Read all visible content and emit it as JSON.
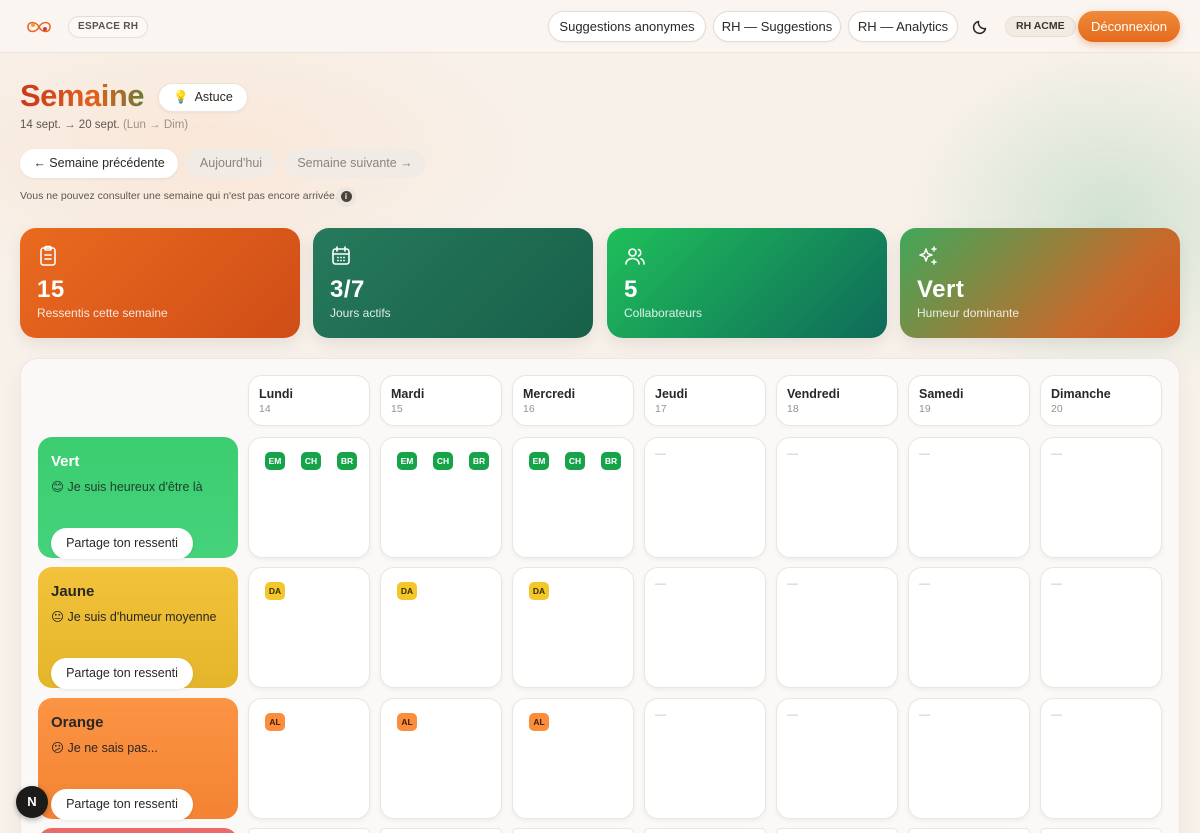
{
  "topbar": {
    "espace": "ESPACE RH",
    "nav": [
      "Suggestions anonymes",
      "RH — Suggestions",
      "RH — Analytics"
    ],
    "company": "RH ACME",
    "logout": "Déconnexion"
  },
  "header": {
    "title": "Semaine",
    "tip": "Astuce",
    "range": "14 sept. → 20 sept.",
    "range_hint": "(Lun → Dim)",
    "prev": "← Semaine précédente",
    "today": "Aujourd'hui",
    "next": "Semaine suivante →",
    "notice": "Vous ne pouvez consulter une semaine qui n'est pas encore arrivée."
  },
  "stats": [
    {
      "value": "15",
      "label": "Ressentis cette semaine",
      "icon": "clipboard-icon"
    },
    {
      "value": "3/7",
      "label": "Jours actifs",
      "icon": "calendar-icon"
    },
    {
      "value": "5",
      "label": "Collaborateurs",
      "icon": "users-icon"
    },
    {
      "value": "Vert",
      "label": "Humeur dominante",
      "icon": "sparkles-icon"
    }
  ],
  "days": [
    {
      "name": "Lundi",
      "date": "14"
    },
    {
      "name": "Mardi",
      "date": "15"
    },
    {
      "name": "Mercredi",
      "date": "16"
    },
    {
      "name": "Jeudi",
      "date": "17"
    },
    {
      "name": "Vendredi",
      "date": "18"
    },
    {
      "name": "Samedi",
      "date": "19"
    },
    {
      "name": "Dimanche",
      "date": "20"
    }
  ],
  "moods": [
    {
      "name": "Vert",
      "emoji": "😊",
      "desc": "Je suis heureux d'être là",
      "button": "Partage ton ressenti",
      "badges": [
        [
          "EM",
          "CH",
          "BR"
        ],
        [
          "EM",
          "CH",
          "BR"
        ],
        [
          "EM",
          "CH",
          "BR"
        ],
        [],
        [],
        [],
        []
      ],
      "color": "#16a34a"
    },
    {
      "name": "Jaune",
      "emoji": "😐",
      "desc": "Je suis d'humeur moyenne",
      "button": "Partage ton ressenti",
      "badges": [
        [
          "DA"
        ],
        [
          "DA"
        ],
        [
          "DA"
        ],
        [],
        [],
        [],
        []
      ],
      "color": "#f3c62a"
    },
    {
      "name": "Orange",
      "emoji": "😕",
      "desc": "Je ne sais pas...",
      "button": "Partage ton ressenti",
      "badges": [
        [
          "AL"
        ],
        [
          "AL"
        ],
        [
          "AL"
        ],
        [],
        [],
        [],
        []
      ],
      "color": "#fb8e3c"
    }
  ],
  "empty_mark": "—",
  "next_badge": "N"
}
